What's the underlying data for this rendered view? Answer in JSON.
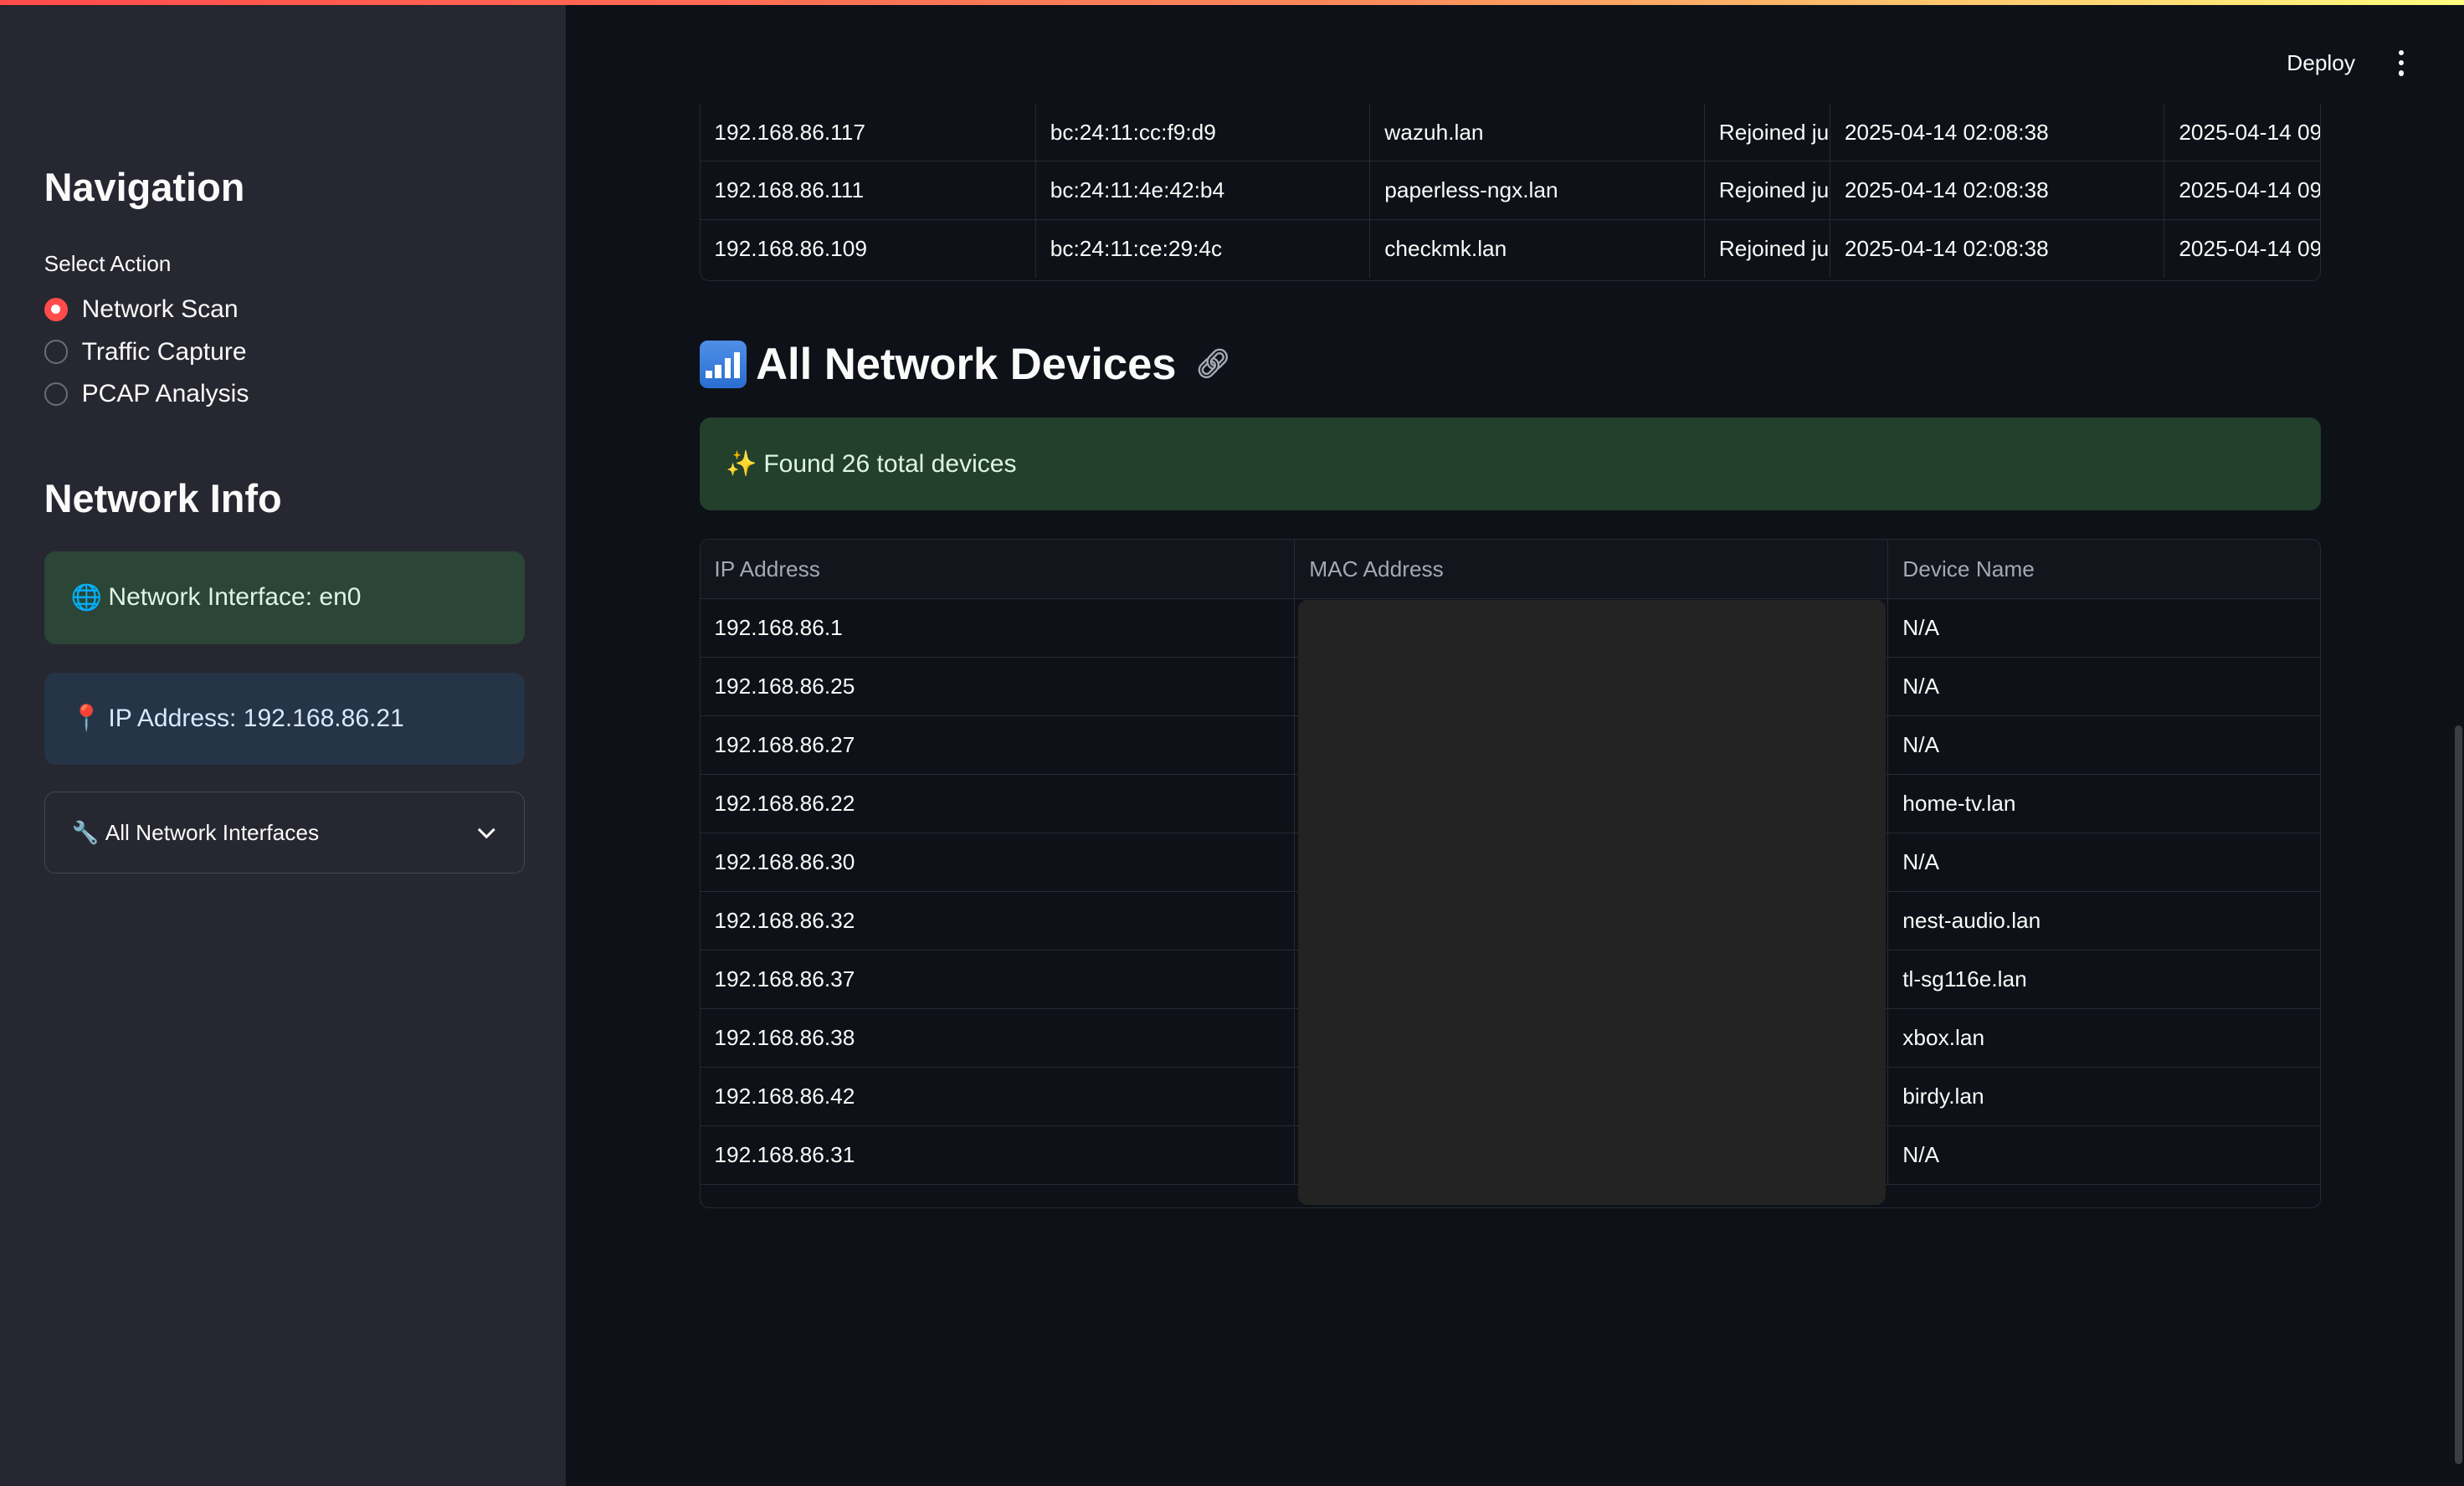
{
  "header": {
    "deploy_label": "Deploy"
  },
  "sidebar": {
    "navigation_title": "Navigation",
    "select_action_label": "Select Action",
    "actions": [
      {
        "label": "Network Scan",
        "selected": true
      },
      {
        "label": "Traffic Capture",
        "selected": false
      },
      {
        "label": "PCAP Analysis",
        "selected": false
      }
    ],
    "network_info_title": "Network Info",
    "interface_icon": "globe-icon",
    "interface_text": "Network Interface: en0",
    "ip_icon": "pin-icon",
    "ip_text": "IP Address: 192.168.86.21",
    "expander_icon": "wrench-icon",
    "expander_label": "All Network Interfaces"
  },
  "top_table": {
    "rows": [
      [
        "192.168.86.117",
        "bc:24:11:cc:f9:d9",
        "wazuh.lan",
        "Rejoined ju",
        "2025-04-14 02:08:38",
        "2025-04-14 09:"
      ],
      [
        "192.168.86.111",
        "bc:24:11:4e:42:b4",
        "paperless-ngx.lan",
        "Rejoined ju",
        "2025-04-14 02:08:38",
        "2025-04-14 09:"
      ],
      [
        "192.168.86.109",
        "bc:24:11:ce:29:4c",
        "checkmk.lan",
        "Rejoined ju",
        "2025-04-14 02:08:38",
        "2025-04-14 09:"
      ]
    ]
  },
  "devices_section": {
    "title": "All Network Devices",
    "title_icon": "signal-bars-icon",
    "link_icon": "link-icon",
    "found_icon": "sparkles-icon",
    "found_text": "Found 26 total devices"
  },
  "devices_table": {
    "columns": [
      "IP Address",
      "MAC Address",
      "Device Name"
    ],
    "rows": [
      [
        "192.168.86.1",
        "",
        "N/A"
      ],
      [
        "192.168.86.25",
        "",
        "N/A"
      ],
      [
        "192.168.86.27",
        "",
        "N/A"
      ],
      [
        "192.168.86.22",
        "",
        "home-tv.lan"
      ],
      [
        "192.168.86.30",
        "",
        "N/A"
      ],
      [
        "192.168.86.32",
        "",
        "nest-audio.lan"
      ],
      [
        "192.168.86.37",
        "",
        "tl-sg116e.lan"
      ],
      [
        "192.168.86.38",
        "",
        "xbox.lan"
      ],
      [
        "192.168.86.42",
        "",
        "birdy.lan"
      ],
      [
        "192.168.86.31",
        "",
        "N/A"
      ]
    ]
  }
}
